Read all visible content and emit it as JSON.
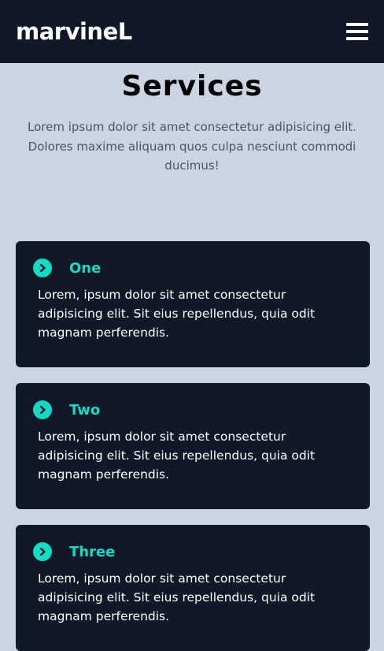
{
  "navbar": {
    "brand": "marvineL",
    "menu_icon": "hamburger-menu-icon"
  },
  "hero": {
    "title": "Services",
    "description": "Lorem ipsum dolor sit amet consectetur adipisicing elit. Dolores maxime aliquam quos culpa nesciunt commodi ducimus!"
  },
  "services": [
    {
      "icon": "chevron-right-circle-icon",
      "title": "One",
      "text": "Lorem, ipsum dolor sit amet consectetur adipisicing elit. Sit eius repellendus, quia odit magnam perferendis."
    },
    {
      "icon": "chevron-right-circle-icon",
      "title": "Two",
      "text": "Lorem, ipsum dolor sit amet consectetur adipisicing elit. Sit eius repellendus, quia odit magnam perferendis."
    },
    {
      "icon": "chevron-right-circle-icon",
      "title": "Three",
      "text": "Lorem, ipsum dolor sit amet consectetur adipisicing elit. Sit eius repellendus, quia odit magnam perferendis."
    }
  ],
  "colors": {
    "navbar_bg": "#111827",
    "page_bg": "#cbd5e1",
    "accent": "#14d9c5"
  }
}
